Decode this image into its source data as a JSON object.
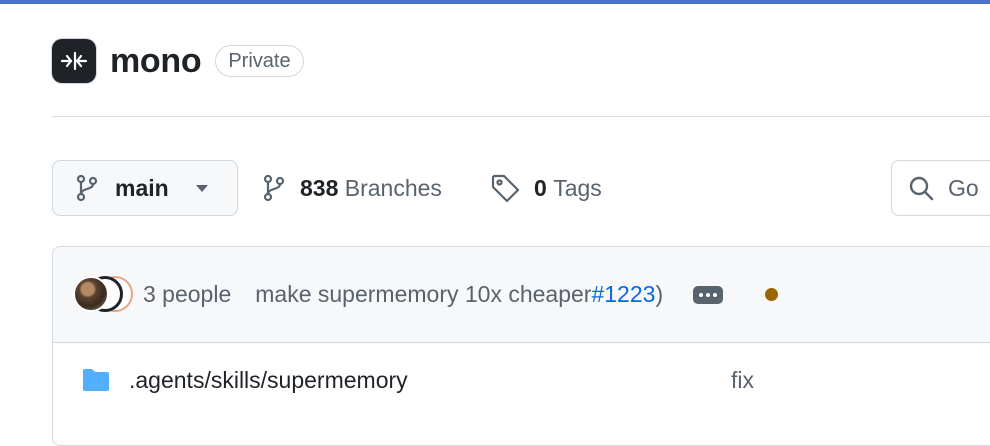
{
  "repo": {
    "name": "mono",
    "visibility": "Private"
  },
  "branch": {
    "current": "main"
  },
  "meta": {
    "branches_count": "838",
    "branches_label": "Branches",
    "tags_count": "0",
    "tags_label": "Tags"
  },
  "search": {
    "placeholder": "Go"
  },
  "commit": {
    "authors": "3 people",
    "message": "make supermemory 10x cheaper",
    "pr_link": "#1223",
    "suffix": ")"
  },
  "files": [
    {
      "name": ".agents/skills/supermemory",
      "message": "fix"
    }
  ],
  "colors": {
    "accent": "#0969da",
    "status_pending": "#9a6700",
    "top_border": "#4a72c8"
  }
}
